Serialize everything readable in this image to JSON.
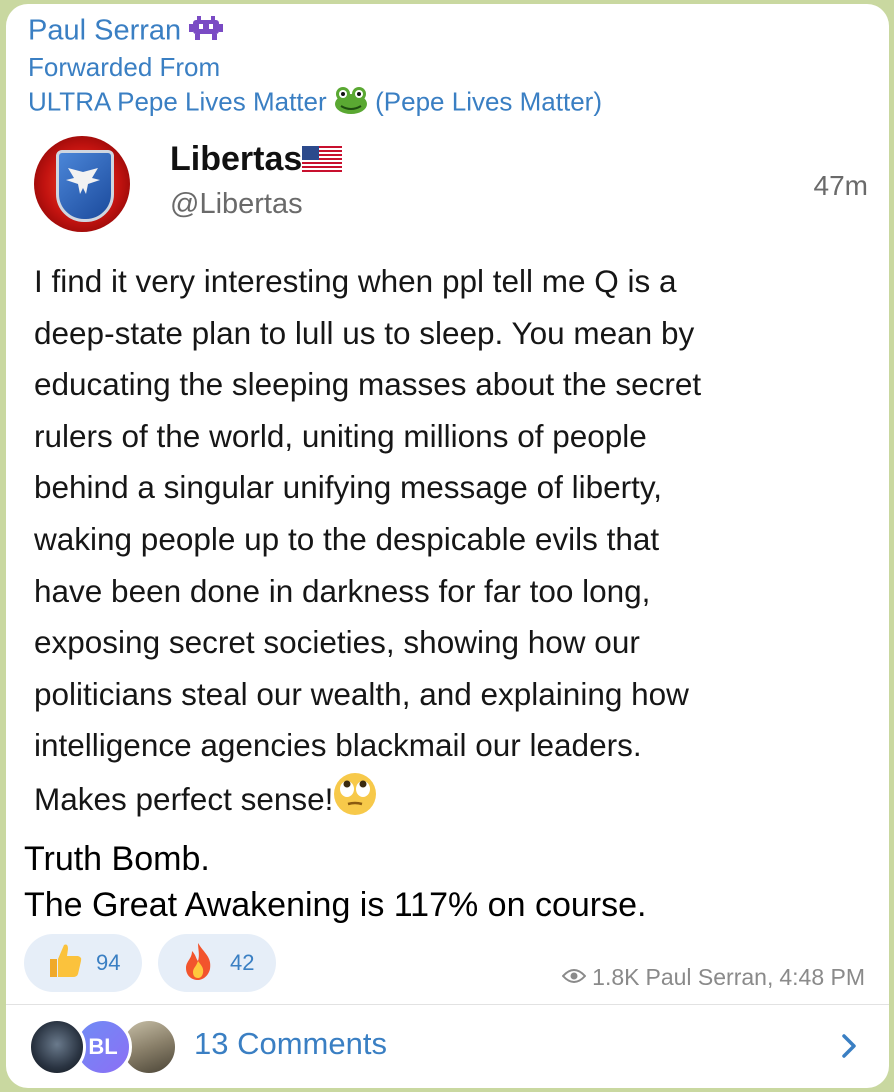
{
  "message": {
    "sender": "Paul Serran",
    "sender_emoji": "alien-monster-icon",
    "forwarded_label": "Forwarded From",
    "forwarded_source": "ULTRA Pepe Lives Matter",
    "forwarded_source_suffix": "(Pepe Lives Matter)"
  },
  "embedded_post": {
    "name": "Libertas",
    "handle": "@Libertas",
    "time": "47m",
    "body": "I find it very interesting when ppl tell me Q is a\ndeep-state plan to lull us to sleep. You mean by\neducating the sleeping masses about the secret\nrulers of the world, uniting millions of people\nbehind a singular unifying message of liberty,\nwaking people up to the despicable evils that\nhave been done in darkness for far too long,\nexposing secret societies, showing how our\npoliticians steal our wealth, and explaining how\nintelligence agencies blackmail our leaders.\nMakes perfect sense!"
  },
  "caption": "Truth Bomb.\nThe Great Awakening is 117% on course.",
  "reactions": [
    {
      "icon": "thumbs-up-icon",
      "count": "94"
    },
    {
      "icon": "fire-icon",
      "count": "42"
    }
  ],
  "meta": {
    "views": "1.8K",
    "author": "Paul Serran,",
    "time": "4:48 PM"
  },
  "comments": {
    "avatar_initials": "BL",
    "label": "13 Comments"
  },
  "colors": {
    "accent": "#3a7fc3",
    "background": "#c9d8a0",
    "reaction_bg": "#e6eef8"
  }
}
